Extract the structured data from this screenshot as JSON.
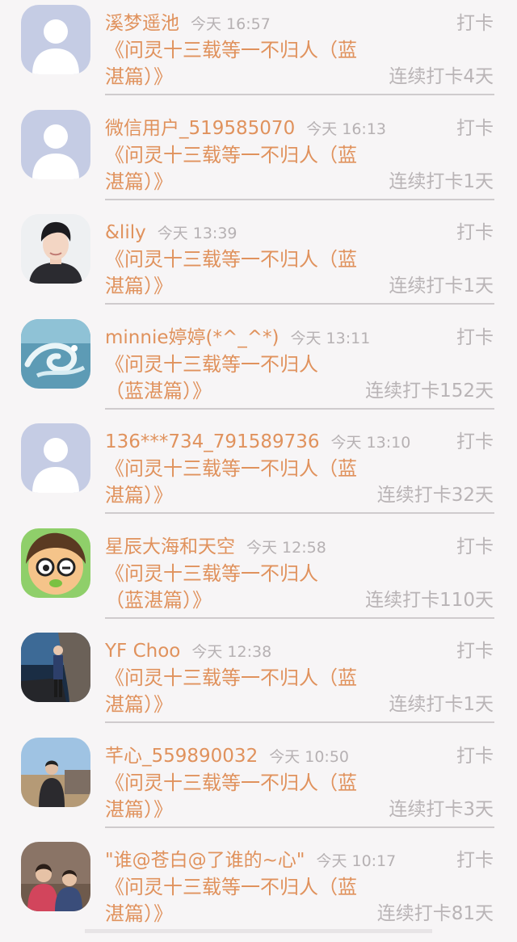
{
  "feed": {
    "items": [
      {
        "name": "溪梦遥池",
        "time": "今天 16:57",
        "action": "打卡",
        "title": "《问灵十三载等一不归人（蓝湛篇）》",
        "streak": "连续打卡4天",
        "avatar_icon": "default-user-icon"
      },
      {
        "name": "微信用户_519585070",
        "time": "今天 16:13",
        "action": "打卡",
        "title": "《问灵十三载等一不归人（蓝湛篇）》",
        "streak": "连续打卡1天",
        "avatar_icon": "default-user-icon"
      },
      {
        "name": "&lily",
        "time": "今天 13:39",
        "action": "打卡",
        "title": "《问灵十三载等一不归人（蓝湛篇）》",
        "streak": "连续打卡1天",
        "avatar_icon": "portrait-photo"
      },
      {
        "name": "minnie婷婷(*^_^*)",
        "time": "今天 13:11",
        "action": "打卡",
        "title": "《问灵十三载等一不归人（蓝湛篇）》",
        "streak": "连续打卡152天",
        "avatar_icon": "water-dragon-photo"
      },
      {
        "name": "136***734_791589736",
        "time": "今天 13:10",
        "action": "打卡",
        "title": "《问灵十三载等一不归人（蓝湛篇）》",
        "streak": "连续打卡32天",
        "avatar_icon": "default-user-icon"
      },
      {
        "name": "星辰大海和天空",
        "time": "今天 12:58",
        "action": "打卡",
        "title": "《问灵十三载等一不归人（蓝湛篇）》",
        "streak": "连续打卡110天",
        "avatar_icon": "cartoon-face"
      },
      {
        "name": "YF Choo",
        "time": "今天 12:38",
        "action": "打卡",
        "title": "《问灵十三载等一不归人（蓝湛篇）》",
        "streak": "连续打卡1天",
        "avatar_icon": "person-cliff-photo"
      },
      {
        "name": "芊心_559890032",
        "time": "今天 10:50",
        "action": "打卡",
        "title": "《问灵十三载等一不归人（蓝湛篇）》",
        "streak": "连续打卡3天",
        "avatar_icon": "person-outdoor-photo"
      },
      {
        "name": "\"谁@苍白@了谁的~心\"",
        "time": "今天 10:17",
        "action": "打卡",
        "title": "《问灵十三载等一不归人（蓝湛篇）》",
        "streak": "连续打卡81天",
        "avatar_icon": "two-children-photo"
      }
    ]
  },
  "colors": {
    "accent": "#e0925d",
    "muted": "#b9b4b6",
    "background": "#f7f5f6",
    "avatar_default": "#c5cce4"
  }
}
